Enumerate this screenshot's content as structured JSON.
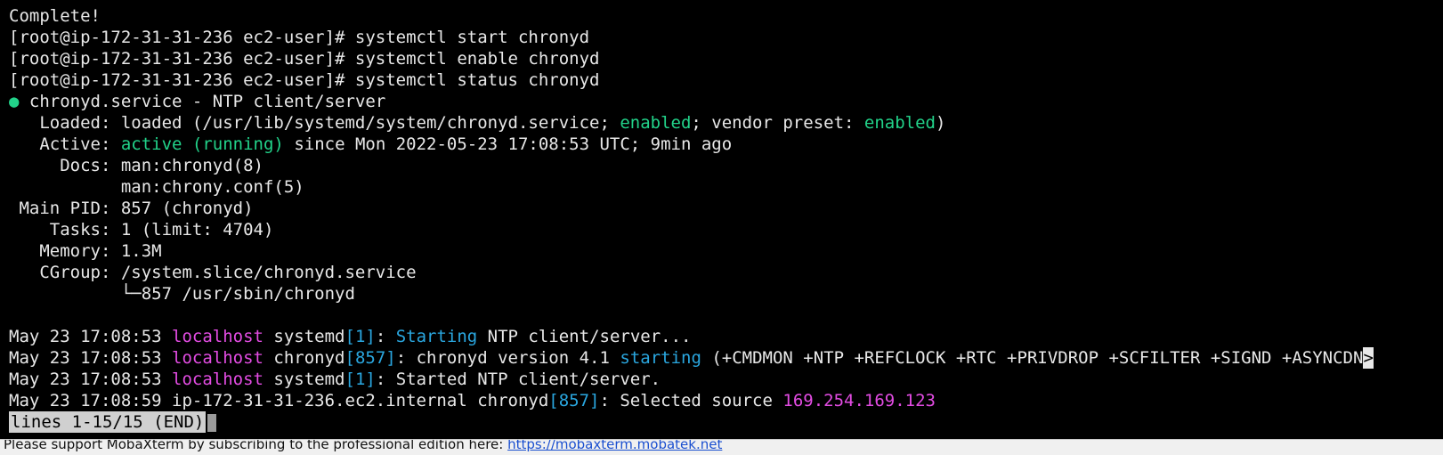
{
  "terminal": {
    "complete": "Complete!",
    "cmd_start": "[root@ip-172-31-31-236 ec2-user]# systemctl start chronyd",
    "cmd_enable": "[root@ip-172-31-31-236 ec2-user]# systemctl enable chronyd",
    "cmd_status": "[root@ip-172-31-31-236 ec2-user]# systemctl status chronyd",
    "service_bullet": "●",
    "service_title": " chronyd.service - NTP client/server",
    "loaded_prefix": "   Loaded: loaded (/usr/lib/systemd/system/chronyd.service; ",
    "loaded_enabled": "enabled",
    "loaded_mid": "; vendor preset: ",
    "loaded_preset": "enabled",
    "loaded_suffix": ")",
    "active_prefix": "   Active: ",
    "active_state": "active (running)",
    "active_suffix": " since Mon 2022-05-23 17:08:53 UTC; 9min ago",
    "docs_1": "     Docs: man:chronyd(8)",
    "docs_2": "           man:chrony.conf(5)",
    "main_pid": " Main PID: 857 (chronyd)",
    "tasks": "    Tasks: 1 (limit: 4704)",
    "memory": "   Memory: 1.3M",
    "cgroup": "   CGroup: /system.slice/chronyd.service",
    "cgroup_child": "           └─857 /usr/sbin/chronyd",
    "log1_time": "May 23 17:08:53 ",
    "log1_host": "localhost",
    "log1_proc": " systemd",
    "log1_pid": "[1]",
    "log1_sep": ": ",
    "log1_word": "Starting",
    "log1_rest": " NTP client/server...",
    "log2_time": "May 23 17:08:53 ",
    "log2_host": "localhost",
    "log2_proc": " chronyd",
    "log2_pid": "[857]",
    "log2_mid": ": chronyd version 4.1 ",
    "log2_word": "starting",
    "log2_rest": " (+CMDMON +NTP +REFCLOCK +RTC +PRIVDROP +SCFILTER +SIGND +ASYNCDN",
    "log2_trunc": ">",
    "log3_time": "May 23 17:08:53 ",
    "log3_host": "localhost",
    "log3_proc": " systemd",
    "log3_pid": "[1]",
    "log3_rest": ": Started NTP client/server.",
    "log4_time": "May 23 17:08:59 ip-172-31-31-236.ec2.internal chronyd",
    "log4_pid": "[857]",
    "log4_mid": ": Selected source ",
    "log4_ip": "169.254.169.123",
    "pager_status": "lines 1-15/15 (END)"
  },
  "footer": {
    "text": "Please support MobaXterm by subscribing to the professional edition here: ",
    "link": "https://mobaxterm.mobatek.net"
  },
  "colors": {
    "terminal_bg": "#000000",
    "text": "#e8e8e8",
    "green": "#22d38a",
    "magenta": "#e34ce3",
    "cyan": "#2aa7e0"
  }
}
